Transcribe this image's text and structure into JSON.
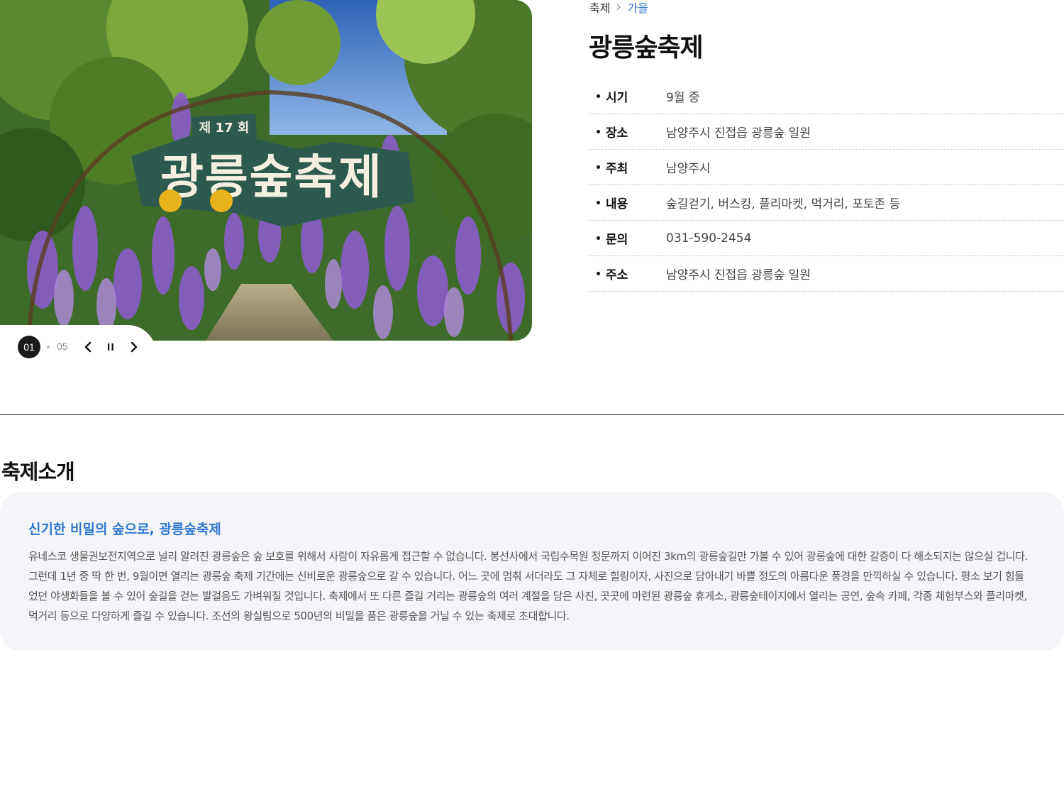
{
  "hero": {
    "sign_small": "제 17 회",
    "sign_main": "광릉숲축제"
  },
  "slider": {
    "current": "01",
    "total": "05",
    "icons": {
      "prev": "chevron-left-icon",
      "pause": "pause-icon",
      "next": "chevron-right-icon"
    }
  },
  "breadcrumb": {
    "items": [
      "축제",
      "가을"
    ],
    "separator_icon": "chevron-right-icon"
  },
  "title": "광릉숲축제",
  "info": [
    {
      "label": "시기",
      "value": "9월 중"
    },
    {
      "label": "장소",
      "value": "남양주시 진접읍 광릉숲 일원"
    },
    {
      "label": "주최",
      "value": "남양주시"
    },
    {
      "label": "내용",
      "value": "숲길걷기, 버스킹, 플리마켓, 먹거리, 포토존 등"
    },
    {
      "label": "문의",
      "value": "031-590-2454"
    },
    {
      "label": "주소",
      "value": "남양주시 진접읍 광릉숲 일원"
    }
  ],
  "section": {
    "title": "축제소개",
    "heading": "신기한 비밀의 숲으로, 광릉숲축제",
    "body": "유네스코 생물권보전지역으로 널리 알려진 광릉숲은 숲 보호를 위해서 사람이 자유롭게 접근할 수 없습니다. 봉선사에서 국립수목원 정문까지 이어진 3km의 광릉숲길만 가볼 수 있어 광릉숲에 대한 갈증이 다 해소되지는 않으실 겁니다. 그런데 1년 중 딱 한 번, 9월이면 열리는 광릉숲 축제 기간에는 신비로운 광릉숲으로 갈 수 있습니다. 어느 곳에 멈춰 서더라도 그 자체로 힐링이자, 사진으로 담아내기 바쁠 정도의 아름다운 풍경을 만끽하실 수 있습니다. 평소 보기 힘들었던 야생화들을 볼 수 있어 숲길을 걷는 발걸음도 가벼워질 것입니다. 축제에서 또 다른 즐길 거리는 광릉숲의 여러 계절을 담은 사진, 곳곳에 마련된 광릉숲 휴게소, 광릉숲테이지에서 열리는 공연, 숲속 카페, 각종 체험부스와 플리마켓, 먹거리 등으로 다양하게 즐길 수 있습니다. 조선의 왕실림으로 500년의 비밀을 품은 광릉숲을 거닐 수 있는 축제로 초대합니다."
  },
  "colors": {
    "accent": "#2f77d0",
    "box_bg": "#f3f5f8",
    "sign_bg": "#2c5a4f",
    "sign_yellow": "#e8b21c"
  }
}
